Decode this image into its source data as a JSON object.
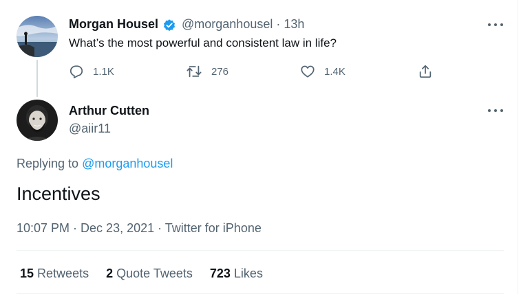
{
  "parent_tweet": {
    "author_name": "Morgan Housel",
    "handle": "@morganhousel",
    "separator": "·",
    "time_ago": "13h",
    "text": "What’s the most powerful and consistent law in life?",
    "reply_count": "1.1K",
    "retweet_count": "276",
    "like_count": "1.4K",
    "icons": [
      "reply-icon",
      "retweet-icon",
      "like-icon",
      "share-icon",
      "verified-badge-icon",
      "more-options-icon"
    ]
  },
  "main_tweet": {
    "author_name": "Arthur Cutten",
    "handle": "@aiir11",
    "replying_prefix": "Replying to ",
    "replying_to": "@morganhousel",
    "text": "Incentives",
    "timestamp": "10:07 PM · Dec 23, 2021 · Twitter for iPhone",
    "stats": {
      "retweets_count": "15",
      "retweets_label": "Retweets",
      "quote_count": "2",
      "quote_label": "Quote Tweets",
      "likes_count": "723",
      "likes_label": "Likes"
    }
  },
  "colors": {
    "text": "#0f1419",
    "secondary": "#536471",
    "link": "#1d9bf0",
    "border": "#eff3f4"
  }
}
